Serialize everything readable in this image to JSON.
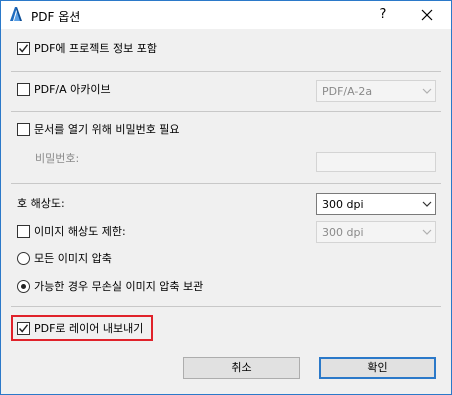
{
  "window": {
    "title": "PDF 옵션"
  },
  "titlebar": {
    "help_label": "?"
  },
  "options": {
    "include_project_info": {
      "label": "PDF에 프로젝트 정보 포함",
      "checked": true
    },
    "pdfa_archive": {
      "label": "PDF/A 아카이브",
      "checked": false,
      "select_value": "PDF/A-2a"
    },
    "password_required": {
      "label": "문서를 열기 위해 비밀번호 필요",
      "checked": false
    },
    "password": {
      "label": "비밀번호:",
      "value": ""
    },
    "resolution": {
      "label": "호 해상도:",
      "select_value": "300 dpi"
    },
    "limit_image_resolution": {
      "label": "이미지 해상도 제한:",
      "checked": false,
      "select_value": "300 dpi"
    },
    "compress_all": {
      "label": "모든 이미지 압축",
      "selected": false
    },
    "lossless_where_possible": {
      "label": "가능한 경우 무손실 이미지 압축 보관",
      "selected": true
    },
    "export_layers": {
      "label": "PDF로 레이어 내보내기",
      "checked": true
    }
  },
  "buttons": {
    "cancel_label": "취소",
    "ok_label": "확인"
  },
  "colors": {
    "highlight": "#e0222a",
    "accent": "#2b79c9"
  }
}
